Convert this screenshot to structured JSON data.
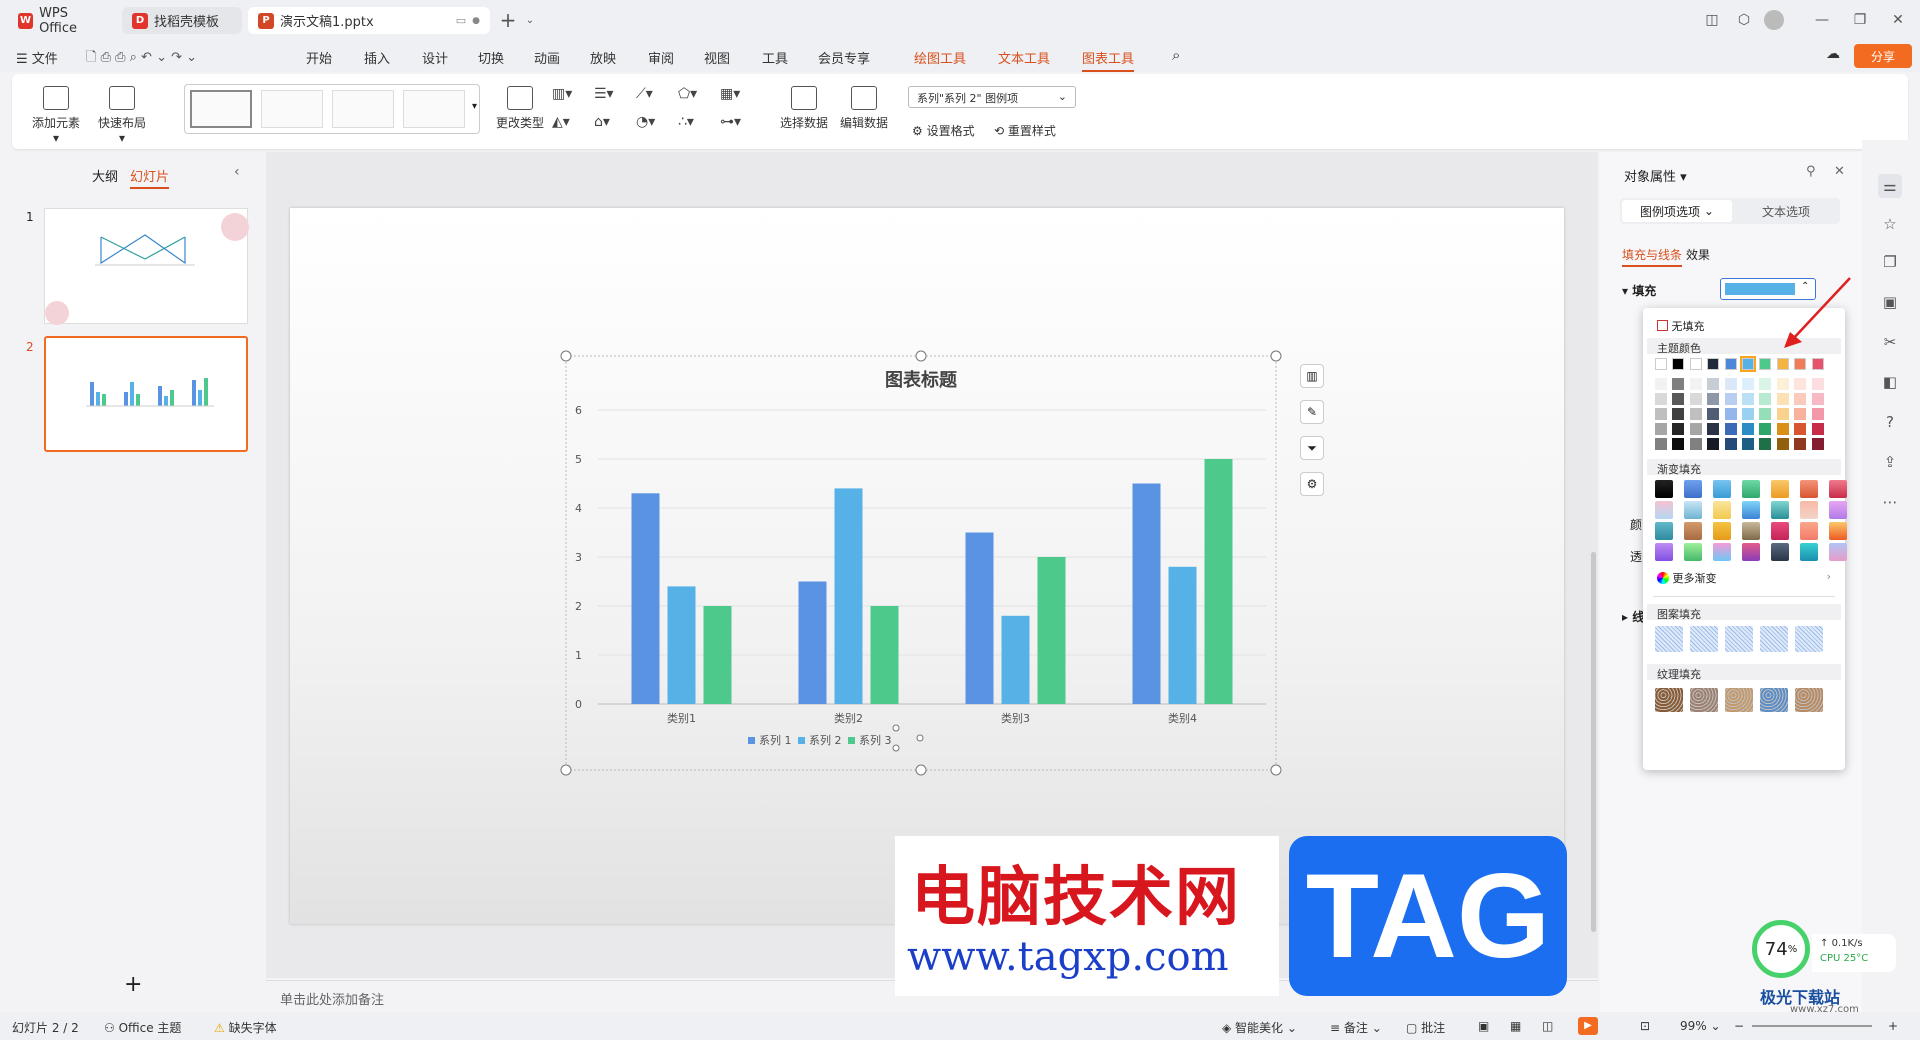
{
  "titlebar": {
    "tabs": [
      {
        "label": "WPS Office",
        "icon_color": "#e0342c"
      },
      {
        "label": "找稻壳模板",
        "icon_color": "#e0342c"
      },
      {
        "label": "演示文稿1.pptx",
        "icon_color": "#d24726"
      }
    ],
    "new_tab_icon": "plus-icon"
  },
  "menu": {
    "file": "文件",
    "items": [
      "开始",
      "插入",
      "设计",
      "切换",
      "动画",
      "放映",
      "审阅",
      "视图",
      "工具",
      "会员专享"
    ],
    "context_items": [
      "绘图工具",
      "文本工具",
      "图表工具"
    ],
    "active": "图表工具",
    "share": "分享"
  },
  "ribbon": {
    "add_element": "添加元素",
    "quick_layout": "快速布局",
    "change_type": "更改类型",
    "select_data": "选择数据",
    "edit_data": "编辑数据",
    "element_combo": "系列\"系列 2\" 图例项",
    "set_format": "设置格式",
    "reset_style": "重置样式"
  },
  "leftpanel": {
    "outline_tab": "大纲",
    "slides_tab": "幻灯片",
    "slide_numbers": [
      "1",
      "2"
    ],
    "add_slide": "+"
  },
  "chart_data": {
    "type": "bar",
    "title": "图表标题",
    "categories": [
      "类别1",
      "类别2",
      "类别3",
      "类别4"
    ],
    "series": [
      {
        "name": "系列 1",
        "values": [
          4.3,
          2.5,
          3.5,
          4.5
        ],
        "color": "#5b93e3"
      },
      {
        "name": "系列 2",
        "values": [
          2.4,
          4.4,
          1.8,
          2.8
        ],
        "color": "#56b1e6"
      },
      {
        "name": "系列 3",
        "values": [
          2.0,
          2.0,
          3.0,
          5.0
        ],
        "color": "#4dc98c"
      }
    ],
    "ylim": [
      0,
      6
    ],
    "yticks": [
      "0",
      "1",
      "2",
      "3",
      "4",
      "5",
      "6"
    ],
    "grid": true,
    "legend": "bottom"
  },
  "notes_placeholder": "单击此处添加备注",
  "rightpanel": {
    "title": "对象属性",
    "tab_legend": "图例项选项",
    "tab_text": "文本选项",
    "subtab_fill": "填充与线条",
    "subtab_effect": "效果",
    "fill_label": "填充",
    "fill_color": "#56b1e6",
    "partial_labels": [
      "颜",
      "透",
      "线"
    ]
  },
  "colorpop": {
    "no_fill": "无填充",
    "theme_colors": "主题颜色",
    "gradient_fill": "渐变填充",
    "more_gradient": "更多渐变",
    "pattern_fill": "图案填充",
    "texture_fill": "纹理填充",
    "theme_row": [
      "#ffffff",
      "#000000",
      "#ffffff",
      "#1f2a3c",
      "#4e86d8",
      "#56b1e6",
      "#4dc98c",
      "#f5b342",
      "#f27c5a",
      "#e8526a"
    ],
    "shade_cols": [
      [
        "#f2f2f2",
        "#d9d9d9",
        "#bfbfbf",
        "#a6a6a6",
        "#808080"
      ],
      [
        "#7f7f7f",
        "#595959",
        "#404040",
        "#262626",
        "#0d0d0d"
      ],
      [
        "#f2f2f2",
        "#d9d9d9",
        "#bfbfbf",
        "#a6a6a6",
        "#808080"
      ],
      [
        "#c8ccd4",
        "#8e97a8",
        "#515d75",
        "#2a3345",
        "#151a23"
      ],
      [
        "#dce7f8",
        "#b8cff1",
        "#94b6ea",
        "#3b6bb8",
        "#274978"
      ],
      [
        "#ddeffa",
        "#bbdff5",
        "#9ad0f0",
        "#2c8dc6",
        "#1d5e84"
      ],
      [
        "#dbf4e8",
        "#b8e9d1",
        "#94dfba",
        "#2ea76b",
        "#1f6f48"
      ],
      [
        "#fdf0d9",
        "#fbe1b3",
        "#f9d28e",
        "#d99017",
        "#90600f"
      ],
      [
        "#fde5de",
        "#facbbd",
        "#f8b19c",
        "#d75530",
        "#8f3920"
      ],
      [
        "#fbdde2",
        "#f7bac5",
        "#f398a8",
        "#c72c48",
        "#851d30"
      ]
    ],
    "gradients": [
      [
        "linear-gradient(#222,#000)",
        "linear-gradient(#6fa0ee,#3d70c9)",
        "linear-gradient(#78c4f0,#3a9bd6)",
        "linear-gradient(#6fd9a5,#2ea76b)",
        "linear-gradient(#f9c86a,#ec9a20)",
        "linear-gradient(#f5957c,#d75530)",
        "linear-gradient(#f17a8e,#c72c48)"
      ],
      [
        "linear-gradient(#f5c3d3,#b4d7f2)",
        "linear-gradient(#c8e6f5,#6fb3d4)",
        "linear-gradient(#f9e59e,#f3c94e)",
        "linear-gradient(#7fd4f6,#3b83d6)",
        "linear-gradient(#7fd6d0,#2a8f98)",
        "linear-gradient(#f7b9a5,#f3d4c8)",
        "linear-gradient(#e7a6f2,#b07be8)"
      ],
      [
        "linear-gradient(#60b9c9,#2e8aa0)",
        "linear-gradient(#d39a6d,#a86a42)",
        "linear-gradient(#f5c242,#e59b1a)",
        "linear-gradient(#c9b89a,#7d6a4a)",
        "linear-gradient(#e84c7a,#c4245a)",
        "linear-gradient(#f9a78c,#f47b6a)",
        "linear-gradient(#fbc86b,#ee5a24)"
      ],
      [
        "linear-gradient(#c08bf5,#8150e0)",
        "linear-gradient(#9ef09a,#45b86a)",
        "linear-gradient(#f49bd8,#6ec8f5)",
        "linear-gradient(#e35d8a,#8a3cb8)",
        "linear-gradient(#5a6b80,#2a3447)",
        "linear-gradient(#3ad0d0,#1a8fb0)",
        "linear-gradient(#b3c3f5,#e89cc8)"
      ]
    ],
    "textures": [
      "#8a5a32",
      "#9e8070",
      "#c49a6c",
      "#5b8ec7",
      "#b88b62"
    ]
  },
  "statusbar": {
    "slide_counter": "幻灯片 2 / 2",
    "theme": "Office 主题",
    "missing_font": "缺失字体",
    "smart_beautify": "智能美化",
    "notes": "备注",
    "comments": "批注",
    "zoom": "99%"
  },
  "system_widget": {
    "cpu_percent": "74",
    "cpu_unit": "%",
    "net": "0.1K/s",
    "cpu_temp": "CPU 25°C"
  },
  "watermark": {
    "site_cn": "电脑技术网",
    "url": "www.tagxp.com",
    "tag": "TAG",
    "corner": "极光下载站",
    "corner_url": "www.xz7.com"
  }
}
